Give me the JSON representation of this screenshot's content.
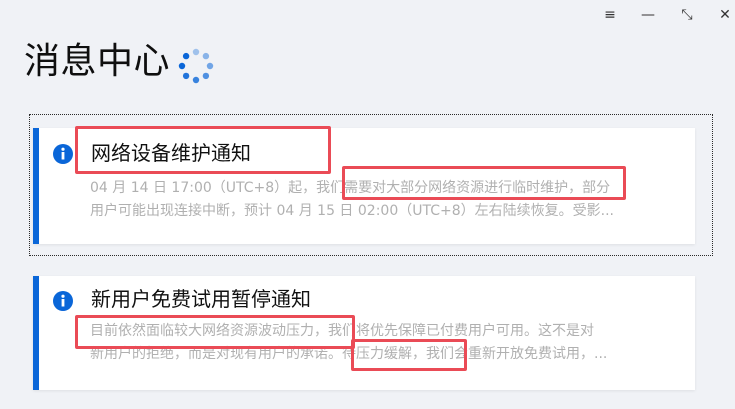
{
  "window": {
    "controls": {
      "menu_icon": "≡",
      "minimize_icon": "—",
      "restore_icon": "⤡",
      "close_icon": "✕"
    }
  },
  "header": {
    "title": "消息中心",
    "loading_icon": "loading-spinner-icon"
  },
  "notifications": [
    {
      "title": "网络设备维护通知",
      "icon": "info-icon",
      "body_lines": [
        "04 月 14 日 17:00（UTC+8）起，我们需要对大部分网络资源进行临时维护，部分",
        "用户可能出现连接中断，预计 04 月 15 日 02:00（UTC+8）左右陆续恢复。受影..."
      ],
      "focused": true
    },
    {
      "title": "新用户免费试用暂停通知",
      "icon": "info-icon",
      "body_lines": [
        "目前依然面临较大网络资源波动压力，我们将优先保障已付费用户可用。这不是对",
        "新用户的拒绝，而是对现有用户的承诺。待压力缓解，我们会重新开放免费试用，..."
      ],
      "focused": false
    }
  ],
  "colors": {
    "background": "#f0f2f6",
    "accent": "#0a66d8",
    "annotation": "#ea4b56",
    "muted_text": "#b0b0b0"
  }
}
